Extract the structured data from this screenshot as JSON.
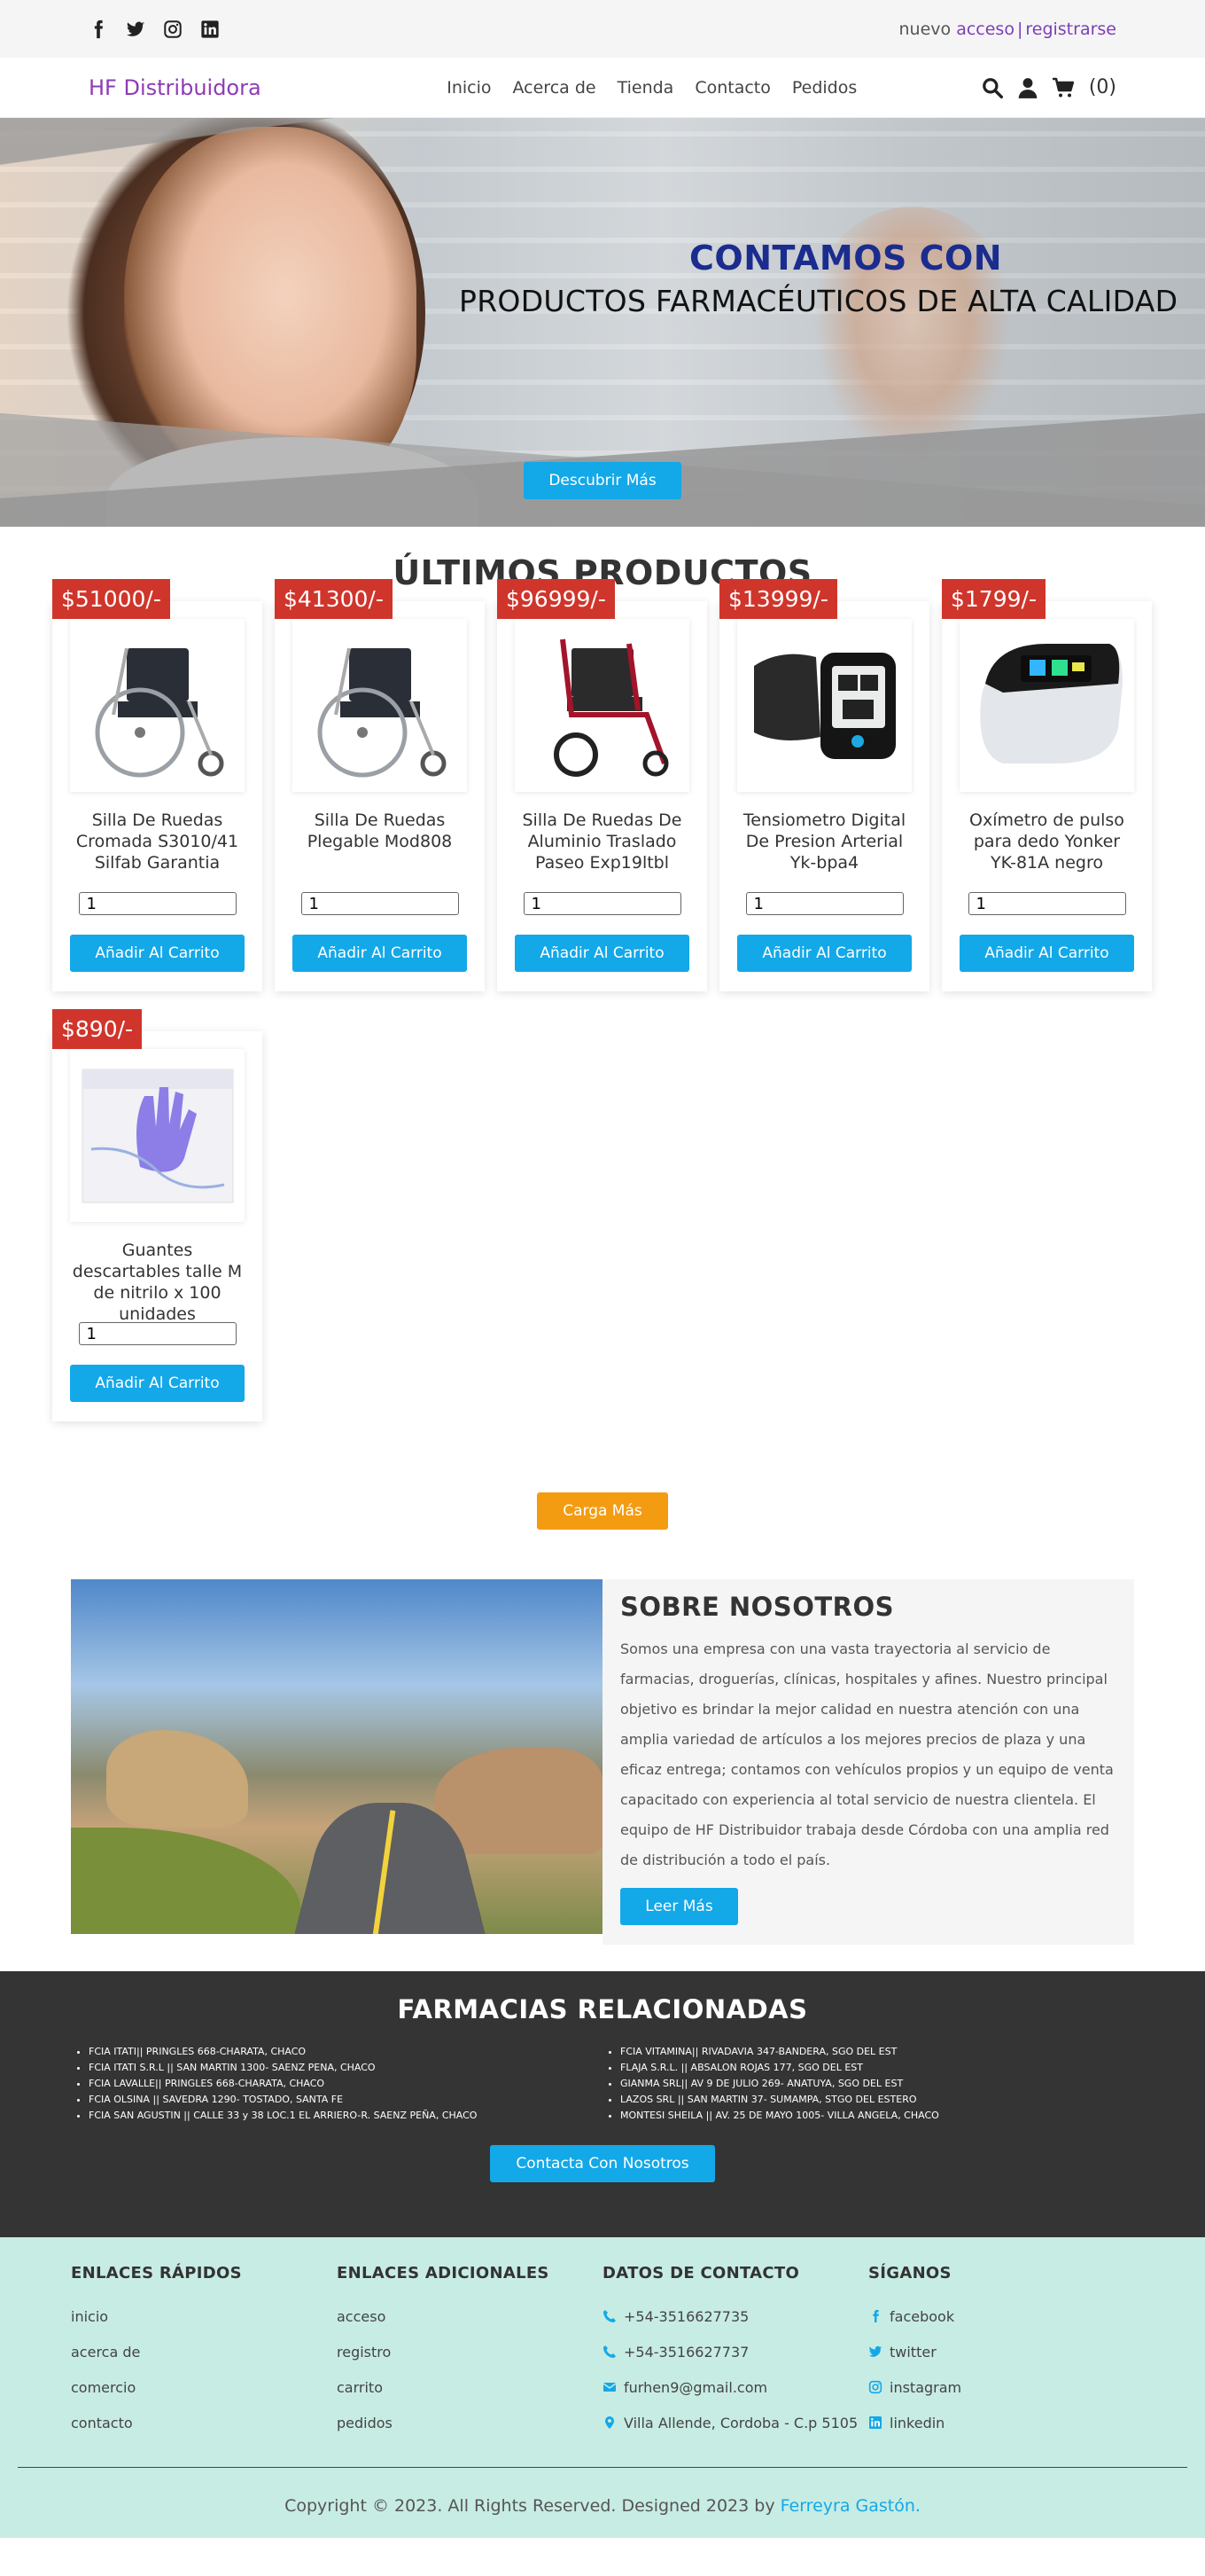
{
  "topbar": {
    "social_icons": [
      "facebook-icon",
      "twitter-icon",
      "instagram-icon",
      "linkedin-icon"
    ],
    "auth_prefix": "nuevo",
    "login_label": "acceso",
    "separator": "|",
    "register_label": "registrarse"
  },
  "nav": {
    "brand": "HF Distribuidora",
    "links": [
      "Inicio",
      "Acerca de",
      "Tienda",
      "Contacto",
      "Pedidos"
    ],
    "cart_count": "(0)"
  },
  "hero": {
    "headline1": "CONTAMOS CON",
    "headline2": "PRODUCTOS FARMACÉUTICOS DE ALTA CALIDAD",
    "button": "Descubrir Más"
  },
  "products": {
    "title": "ÚLTIMOS PRODUCTOS",
    "add_label": "Añadir Al Carrito",
    "items": [
      {
        "price": "$51000/-",
        "name": "Silla De Ruedas Cromada S3010/41 Silfab Garantia",
        "qty": "1"
      },
      {
        "price": "$41300/-",
        "name": "Silla De Ruedas Plegable Mod808",
        "qty": "1"
      },
      {
        "price": "$96999/-",
        "name": "Silla De Ruedas De Aluminio Traslado Paseo Exp19ltbl",
        "qty": "1"
      },
      {
        "price": "$13999/-",
        "name": "Tensiometro Digital De Presion Arterial Yk-bpa4",
        "qty": "1"
      },
      {
        "price": "$1799/-",
        "name": "Oxímetro de pulso para dedo Yonker YK-81A negro",
        "qty": "1"
      },
      {
        "price": "$890/-",
        "name": "Guantes descartables talle M de nitrilo x 100 unidades",
        "qty": "1"
      }
    ],
    "load_more": "Carga Más"
  },
  "about": {
    "title": "SOBRE NOSOTROS",
    "body": "Somos una empresa con una vasta trayectoria al servicio de farmacias, droguerías, clínicas, hospitales y afines. Nuestro principal objetivo es brindar la mejor calidad en nuestra atención con una amplia variedad de artículos a los mejores precios de plaza y una eficaz entrega; contamos con vehículos propios y un equipo de venta capacitado con experiencia al total servicio de nuestra clientela. El equipo de HF Distribuidor trabaja desde Córdoba con una amplia red de distribución a todo el país.",
    "button": "Leer Más"
  },
  "pharmacies": {
    "title": "FARMACIAS RELACIONADAS",
    "left": [
      "FCIA ITATI|| PRINGLES 668-CHARATA, CHACO",
      "FCIA ITATI S.R.L || SAN MARTIN 1300- SAENZ PENA, CHACO",
      "FCIA LAVALLE|| PRINGLES 668-CHARATA, CHACO",
      "FCIA OLSINA || SAVEDRA 1290- TOSTADO, SANTA FE",
      "FCIA SAN AGUSTIN || CALLE 33 y 38 LOC.1 EL ARRIERO-R. SAENZ PEÑA, CHACO"
    ],
    "right": [
      "FCIA VITAMINA|| RIVADAVIA 347-BANDERA, SGO DEL EST",
      "FLAJA S.R.L. || ABSALON ROJAS 177, SGO DEL EST",
      "GIANMA SRL|| AV 9 DE JULIO 269- ANATUYA, SGO DEL EST",
      "LAZOS SRL || SAN MARTIN 37- SUMAMPA, STGO DEL ESTERO",
      "MONTESI SHEILA || AV. 25 DE MAYO 1005- VILLA ANGELA, CHACO"
    ],
    "button": "Contacta Con Nosotros"
  },
  "footer": {
    "quick": {
      "title": "ENLACES RÁPIDOS",
      "links": [
        "inicio",
        "acerca de",
        "comercio",
        "contacto"
      ]
    },
    "extra": {
      "title": "ENLACES ADICIONALES",
      "links": [
        "acceso",
        "registro",
        "carrito",
        "pedidos"
      ]
    },
    "contact": {
      "title": "DATOS DE CONTACTO",
      "items": [
        "+54-3516627735",
        "+54-3516627737",
        "furhen9@gmail.com",
        "Villa Allende, Cordoba - C.p 5105"
      ]
    },
    "follow": {
      "title": "SÍGANOS",
      "items": [
        "facebook",
        "twitter",
        "instagram",
        "linkedin"
      ]
    },
    "copyright": "Copyright © 2023. All Rights Reserved. Designed 2023 by",
    "author": "Ferreyra Gastón."
  },
  "colors": {
    "brand": "#8e3bb5",
    "accent": "#13a8e8",
    "price": "#d0352b",
    "load_more": "#f39c12",
    "footer_bg": "#c7ece3",
    "dark_bg": "#343434"
  }
}
